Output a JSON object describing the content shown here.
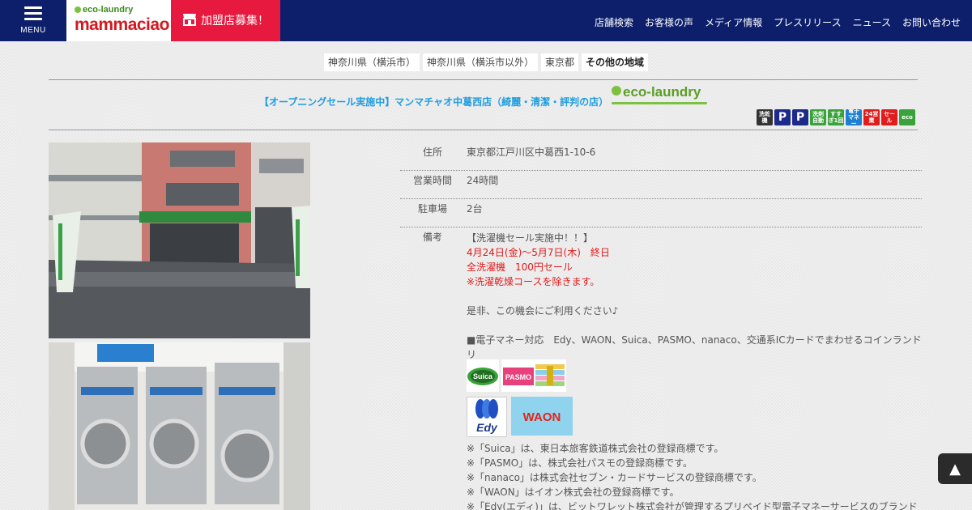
{
  "header": {
    "menu_label": "MENU",
    "logo_eco": "eco-laundry",
    "logo_brand": "mammaciao",
    "franchise_label": "加盟店募集！",
    "nav": [
      "店舗検索",
      "お客様の声",
      "メディア情報",
      "プレスリリース",
      "ニュース",
      "お問い合わせ"
    ]
  },
  "region_tabs": [
    "神奈川県（横浜市）",
    "神奈川県（横浜市以外）",
    "東京都",
    "その他の地域"
  ],
  "shop": {
    "title": "【オープニングセール実施中】マンマチャオ中葛西店（綺麗・清潔・評判の店）",
    "eco_logo": "eco-laundry",
    "service_icons": [
      {
        "name": "washer-dryer-icon",
        "text": "洗乾機",
        "color": "#333333"
      },
      {
        "name": "parking-icon",
        "text": "P",
        "color": "#1d2a8a"
      },
      {
        "name": "parking-space-icon",
        "text": "P",
        "color": "#1d2a8a"
      },
      {
        "name": "auto-detergent-icon",
        "text": "洗剤自動",
        "color": "#3aa23a"
      },
      {
        "name": "rinse-once-icon",
        "text": "すすぎ1回",
        "color": "#3aa23a"
      },
      {
        "name": "e-money-icon",
        "text": "電子マネー",
        "color": "#1f7fd0"
      },
      {
        "name": "24h-icon",
        "text": "24営業",
        "color": "#e21b1b"
      },
      {
        "name": "sale-icon",
        "text": "セール",
        "color": "#e21b1b"
      },
      {
        "name": "eco-icon",
        "text": "eco",
        "color": "#3aa23a"
      }
    ]
  },
  "info": {
    "address_label": "住所",
    "address": "東京都江戸川区中葛西1-10-6",
    "hours_label": "営業時間",
    "hours": "24時間",
    "parking_label": "駐車場",
    "parking": "2台",
    "notes_label": "備考"
  },
  "notes": {
    "line1": "【洗濯機セール実施中！！】",
    "line2": "4月24日(金)〜5月7日(木)　終日",
    "line3": "全洗濯機　100円セール",
    "line4": "※洗濯乾燥コースを除きます。",
    "line5": "是非、この機会にご利用ください♪",
    "line6": "■電子マネー対応　Edy、WAON、Suica、PASMO、nanaco、交通系ICカードでまわせるコインランドリ",
    "line7": "ー"
  },
  "payment": {
    "suica": "Suica",
    "pasmo": "PASMO",
    "edy": "Edy",
    "waon": "WAON"
  },
  "trademarks": [
    "※「Suica」は、東日本旅客鉄道株式会社の登録商標です。",
    "※「PASMO」は、株式会社パスモの登録商標です。",
    "※「nanaco」は株式会社セブン・カードサービスの登録商標です。",
    "※「WAON」はイオン株式会社の登録商標です。",
    "※「Edy(エディ)」は、ビットワレット株式会社が管理するプリペイド型電子マネーサービスのブランド"
  ],
  "pagetop_symbol": "▲"
}
